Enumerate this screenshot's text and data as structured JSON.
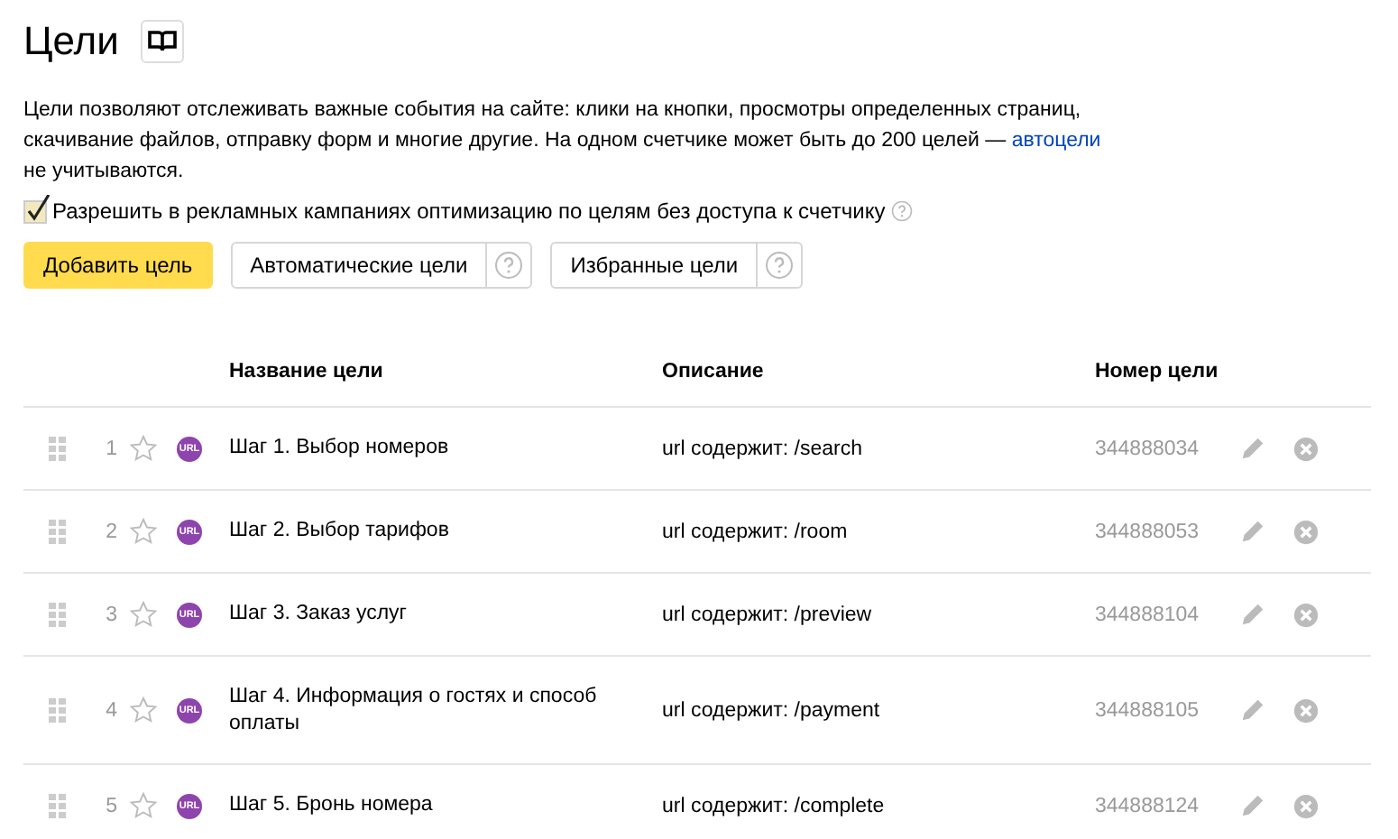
{
  "title": "Цели",
  "intro": {
    "text": "Цели позволяют отслеживать важные события на сайте: клики на кнопки, просмотры определенных страниц, скачивание файлов, отправку форм и многие другие. На одном счетчике может быть до 200 целей — ",
    "link": "автоцели",
    "tail": " не учитываются."
  },
  "option": {
    "label": "Разрешить в рекламных кампаниях оптимизацию по целям без доступа к счетчику",
    "checked": true
  },
  "buttons": [
    {
      "kind": "primary",
      "label": "Добавить цель"
    },
    {
      "kind": "help",
      "label": "Автоматические цели"
    },
    {
      "kind": "help",
      "label": "Избранные цели"
    }
  ],
  "table": {
    "columns": [
      "Название цели",
      "Описание",
      "Номер цели"
    ],
    "rows": [
      {
        "index": "1",
        "favorite": false,
        "badge": "URL",
        "name": "Шаг 1. Выбор номеров",
        "description": "url содержит: /search",
        "number": "344888034"
      },
      {
        "index": "2",
        "favorite": false,
        "badge": "URL",
        "name": "Шаг 2. Выбор тарифов",
        "description": "url содержит: /room",
        "number": "344888053"
      },
      {
        "index": "3",
        "favorite": false,
        "badge": "URL",
        "name": "Шаг 3. Заказ услуг",
        "description": "url содержит: /preview",
        "number": "344888104"
      },
      {
        "index": "4",
        "favorite": false,
        "badge": "URL",
        "name": "Шаг 4. Информация о гостях и способ оплаты",
        "description": "url содержит: /payment",
        "number": "344888105"
      },
      {
        "index": "5",
        "favorite": false,
        "badge": "URL",
        "name": "Шаг 5. Бронь номера",
        "description": "url содержит: /complete",
        "number": "344888124"
      }
    ]
  }
}
